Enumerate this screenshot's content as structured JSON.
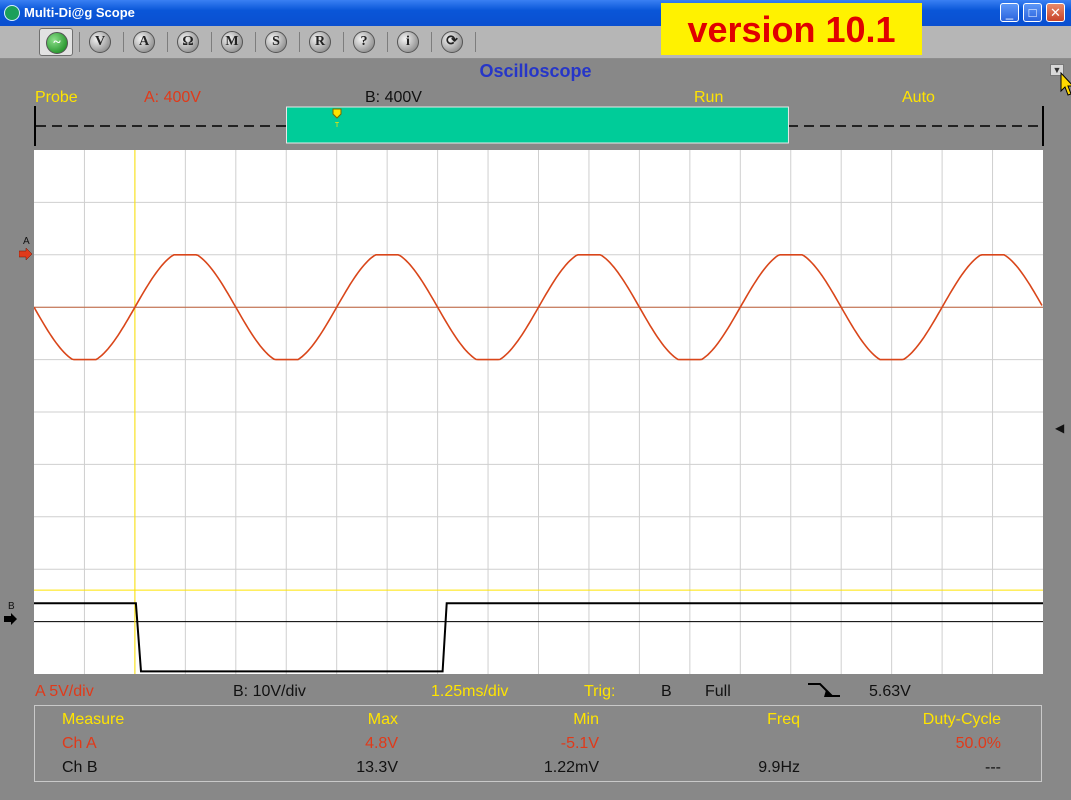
{
  "window": {
    "title": "Multi-Di@g Scope",
    "buttons": {
      "minimize": "_",
      "maximize": "□",
      "close": "✕"
    }
  },
  "toolbar": {
    "buttons": [
      {
        "name": "scope",
        "label": "~"
      },
      {
        "name": "volt",
        "label": "V"
      },
      {
        "name": "amp",
        "label": "A"
      },
      {
        "name": "ohm",
        "label": "Ω"
      },
      {
        "name": "m",
        "label": "M"
      },
      {
        "name": "s",
        "label": "S"
      },
      {
        "name": "r",
        "label": "R"
      },
      {
        "name": "help",
        "label": "?"
      },
      {
        "name": "info",
        "label": "i"
      },
      {
        "name": "refresh",
        "label": "⟳"
      }
    ],
    "version_label": "version 10.1"
  },
  "scope": {
    "title": "Oscilloscope",
    "header": {
      "probe": "Probe",
      "channel_a": "A: 400V",
      "channel_b": "B: 400V",
      "run": "Run",
      "auto": "Auto"
    },
    "timeline": {
      "window_start_frac": 0.25,
      "window_end_frac": 0.747,
      "trigger_marker": "T"
    },
    "markers": {
      "channel_a": "A",
      "channel_b": "B"
    },
    "colors": {
      "channel_a": "#d9461a",
      "channel_b": "#000000",
      "trigger": "#ffe400",
      "grid": "#cfcfcf",
      "window": "#00cc99"
    }
  },
  "chart_data": {
    "type": "line",
    "x_divisions": 20,
    "y_divisions": 10,
    "time_per_div": "1.25ms/div",
    "series": [
      {
        "name": "A",
        "scale": "5V/div",
        "kind": "sine",
        "period_div": 4,
        "amplitude_div": 1.0,
        "phase_start": "zero-falling",
        "offset_div": 7.0
      },
      {
        "name": "B",
        "scale": "10V/div",
        "kind": "square",
        "points_div": [
          [
            0,
            1.35
          ],
          [
            2.02,
            1.35
          ],
          [
            2.12,
            0.05
          ],
          [
            8.1,
            0.05
          ],
          [
            8.18,
            1.35
          ],
          [
            20,
            1.35
          ]
        ],
        "offset_div": 1.0
      }
    ],
    "trigger": {
      "x_div": 2.0,
      "level_y_div": 1.6
    }
  },
  "footer": {
    "channel_a_scale": "A 5V/div",
    "channel_b_scale": "B: 10V/div",
    "timebase": "1.25ms/div",
    "trig_label": "Trig:",
    "trig_channel": "B",
    "trig_mode": "Full",
    "trig_level": "5.63V"
  },
  "measurements": {
    "headers": [
      "Measure",
      "Max",
      "Min",
      "Freq",
      "Duty-Cycle"
    ],
    "rows": [
      [
        "Ch A",
        "4.8V",
        "-5.1V",
        "",
        "50.0%"
      ],
      [
        "Ch B",
        "13.3V",
        "1.22mV",
        "9.9Hz",
        "---"
      ]
    ]
  }
}
